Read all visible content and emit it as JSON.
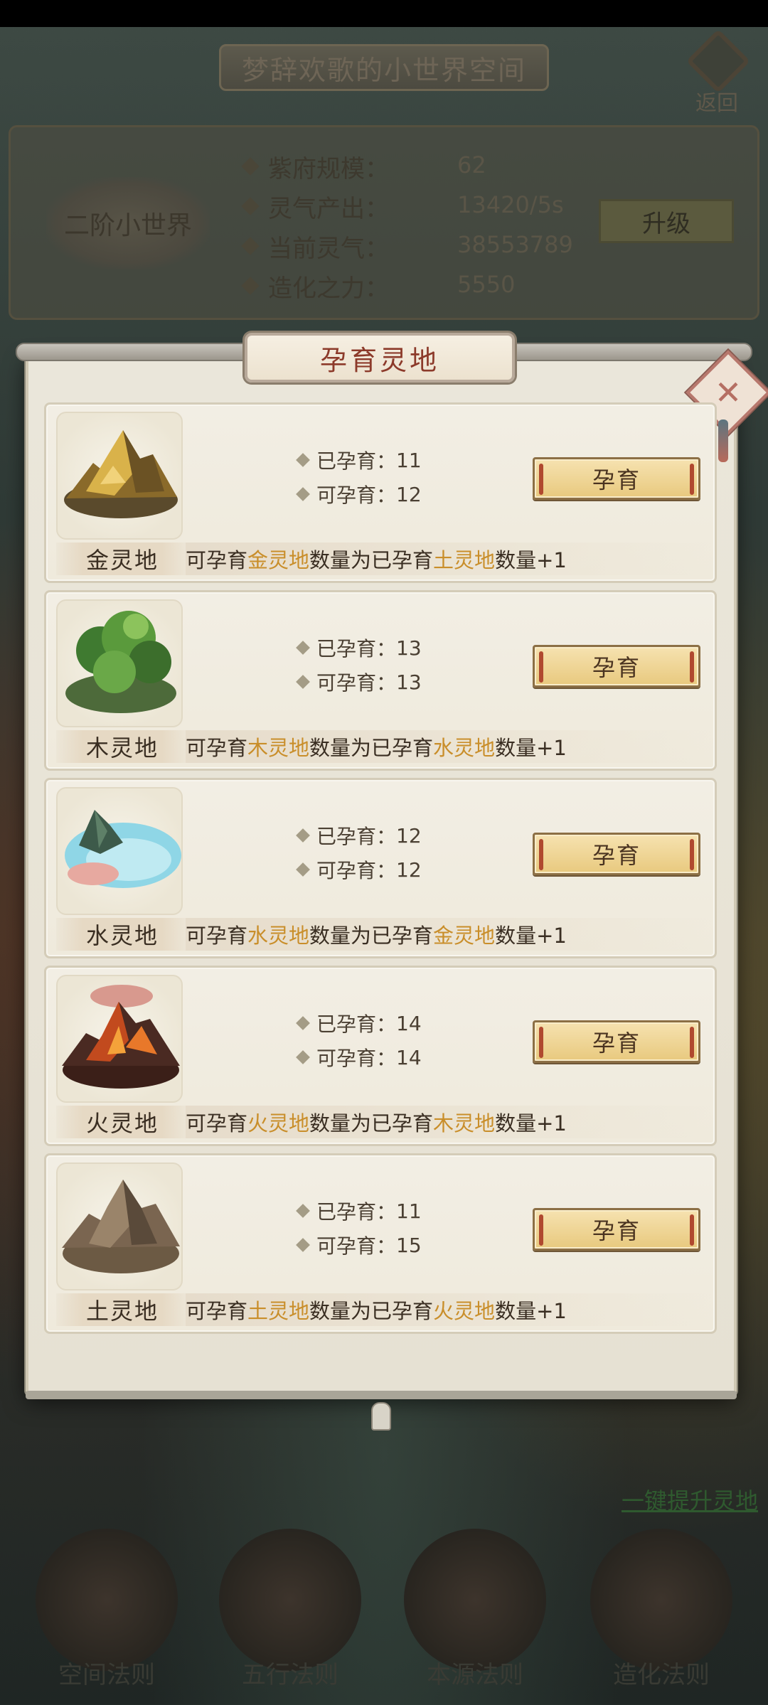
{
  "app": {
    "title": "梦辞欢歌的小世界空间",
    "back_label": "返回"
  },
  "world_info": {
    "tier": "二阶小世界",
    "stats": [
      {
        "label": "紫府规模：",
        "value": "62"
      },
      {
        "label": "灵气产出：",
        "value": "13420/5s"
      },
      {
        "label": "当前灵气：",
        "value": "38553789"
      },
      {
        "label": "造化之力：",
        "value": "5550"
      }
    ],
    "upgrade_label": "升级"
  },
  "modal": {
    "title": "孕育灵地",
    "breed_label": "孕育",
    "bred_prefix": "已孕育：",
    "can_prefix": "可孕育：",
    "rule_prefix": "可孕育",
    "rule_mid": "数量为已孕育",
    "rule_suffix": "数量+1",
    "lands": [
      {
        "name": "金灵地",
        "bred": "11",
        "available": "12",
        "self": "金灵地",
        "source": "土灵地",
        "art": "gold-mountain-icon"
      },
      {
        "name": "木灵地",
        "bred": "13",
        "available": "13",
        "self": "木灵地",
        "source": "水灵地",
        "art": "wood-forest-icon"
      },
      {
        "name": "水灵地",
        "bred": "12",
        "available": "12",
        "self": "水灵地",
        "source": "金灵地",
        "art": "water-lake-icon"
      },
      {
        "name": "火灵地",
        "bred": "14",
        "available": "14",
        "self": "火灵地",
        "source": "木灵地",
        "art": "fire-volcano-icon"
      },
      {
        "name": "土灵地",
        "bred": "11",
        "available": "15",
        "self": "土灵地",
        "source": "火灵地",
        "art": "earth-mountain-icon"
      }
    ]
  },
  "footer": {
    "one_click_link": "一键提升灵地",
    "laws": [
      "空间法则",
      "五行法则",
      "本源法则",
      "造化法则"
    ]
  },
  "colors": {
    "highlight": "#c98e2a",
    "title_red": "#8c3a2a",
    "button_gold": "#e8c97e"
  }
}
